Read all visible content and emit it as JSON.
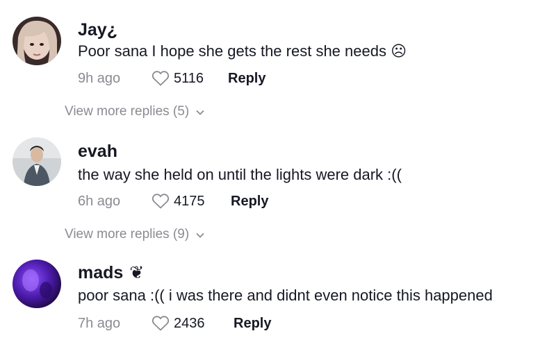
{
  "comments": [
    {
      "username": "Jay¿",
      "badge": "",
      "text": "Poor sana I hope she gets the rest she needs ☹",
      "time": "9h ago",
      "likes": "5116",
      "reply_label": "Reply",
      "avatar_icon": "avatar-photo-girl"
    },
    {
      "username": "evah",
      "badge": "",
      "text": "the way she held on until the lights were dark :((",
      "time": "6h ago",
      "likes": "4175",
      "reply_label": "Reply",
      "avatar_icon": "avatar-photo-man"
    },
    {
      "username": "mads",
      "badge": "❦",
      "text": "poor sana :(( i was there and didnt even notice this happened",
      "time": "7h ago",
      "likes": "2436",
      "reply_label": "Reply",
      "avatar_icon": "avatar-photo-purple"
    }
  ],
  "view_more": [
    {
      "label": "View more replies (5)"
    },
    {
      "label": "View more replies (9)"
    }
  ],
  "icons": {
    "like": "heart-outline-icon",
    "expand": "chevron-down-icon"
  },
  "colors": {
    "text": "#161823",
    "muted": "#8a8b91",
    "background": "#ffffff"
  }
}
